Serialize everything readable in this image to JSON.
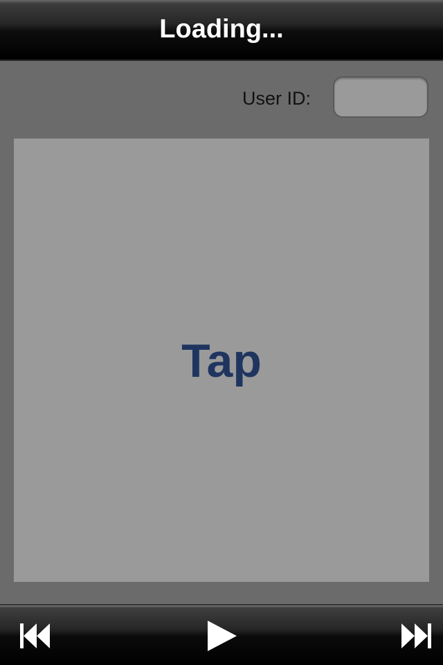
{
  "navbar": {
    "title": "Loading..."
  },
  "form": {
    "user_id_label": "User ID:",
    "user_id_value": ""
  },
  "tap_area": {
    "label": "Tap",
    "label_color": "#1f3560"
  },
  "toolbar": {
    "prev_icon": "skip-back-icon",
    "play_icon": "play-icon",
    "next_icon": "skip-forward-icon"
  }
}
